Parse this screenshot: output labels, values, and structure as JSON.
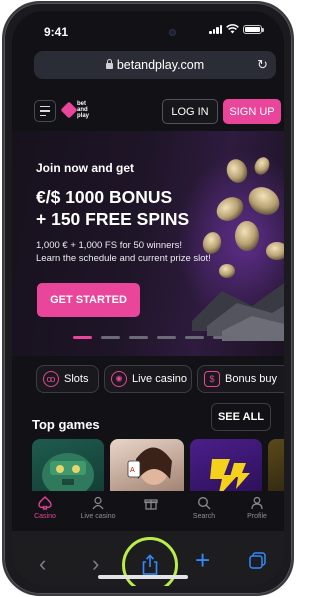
{
  "status": {
    "time": "9:41"
  },
  "browser": {
    "url": "betandplay.com"
  },
  "header": {
    "logo_line1": "bet",
    "logo_line2": "and",
    "logo_line3": "play",
    "login_label": "LOG IN",
    "signup_label": "SIGN UP"
  },
  "banner": {
    "subtitle": "Join now and get",
    "title_line1": "€/$ 1000 BONUS",
    "title_line2": "+ 150 FREE SPINS",
    "desc_line1": "1,000 € + 1,000 FS for 50 winners!",
    "desc_line2": "Learn the schedule and current prize slot!",
    "cta_label": "GET STARTED",
    "active_slide": 1,
    "slide_count": 6
  },
  "categories": [
    {
      "label": "Slots",
      "icon": "cherries-icon"
    },
    {
      "label": "Live casino",
      "icon": "roulette-icon"
    },
    {
      "label": "Bonus buy",
      "icon": "bonus-icon"
    }
  ],
  "top_games": {
    "title": "Top games",
    "see_all_label": "SEE ALL"
  },
  "tabbar": [
    {
      "label": "Casino",
      "icon": "spade-icon",
      "active": true
    },
    {
      "label": "Live casino",
      "icon": "dealer-icon",
      "active": false
    },
    {
      "label": "",
      "icon": "gift-icon",
      "active": false
    },
    {
      "label": "Search",
      "icon": "search-icon",
      "active": false
    },
    {
      "label": "Profile",
      "icon": "profile-icon",
      "active": false
    }
  ],
  "colors": {
    "accent": "#e8459b",
    "background": "#121216",
    "highlight_ring": "#b9ee4a",
    "safari_blue": "#2f8bff"
  }
}
